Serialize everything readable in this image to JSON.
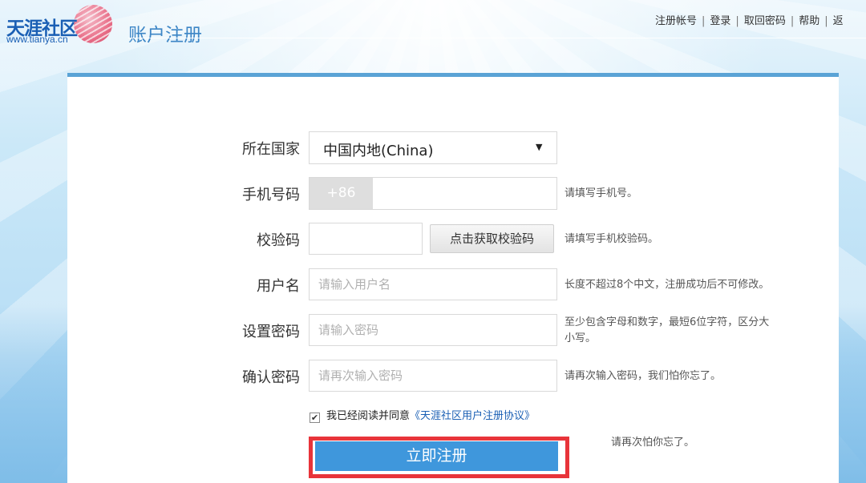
{
  "header": {
    "logo_name": "天涯社区",
    "logo_url": "www.tianya.cn",
    "page_title": "账户注册",
    "nav": [
      "注册帐号",
      "登录",
      "取回密码",
      "帮助",
      "返"
    ]
  },
  "form": {
    "country": {
      "label": "所在国家",
      "value": "中国内地(China)"
    },
    "phone": {
      "label": "手机号码",
      "prefix": "+86",
      "hint": "请填写手机号。"
    },
    "verify": {
      "label": "校验码",
      "button": "点击获取校验码",
      "hint": "请填写手机校验码。"
    },
    "username": {
      "label": "用户名",
      "placeholder": "请输入用户名",
      "hint": "长度不超过8个中文，注册成功后不可修改。"
    },
    "password": {
      "label": "设置密码",
      "placeholder": "请输入密码",
      "hint_line1": "至少包含字母和数字，最短6位字符，区分大",
      "hint_line2": "小写。"
    },
    "confirm": {
      "label": "确认密码",
      "placeholder": "请再次输入密码",
      "hint": "请再次输入密码，我们怕你忘了。"
    },
    "agree": {
      "text": "我已经阅读并同意",
      "link": "《天涯社区用户注册协议》",
      "check_mark": "✔"
    },
    "faded_hint": "请再次怕你忘了。",
    "submit": "立即注册"
  },
  "colors": {
    "accent": "#3f97dc",
    "highlight": "#e8343a",
    "link": "#1a5fb4"
  }
}
